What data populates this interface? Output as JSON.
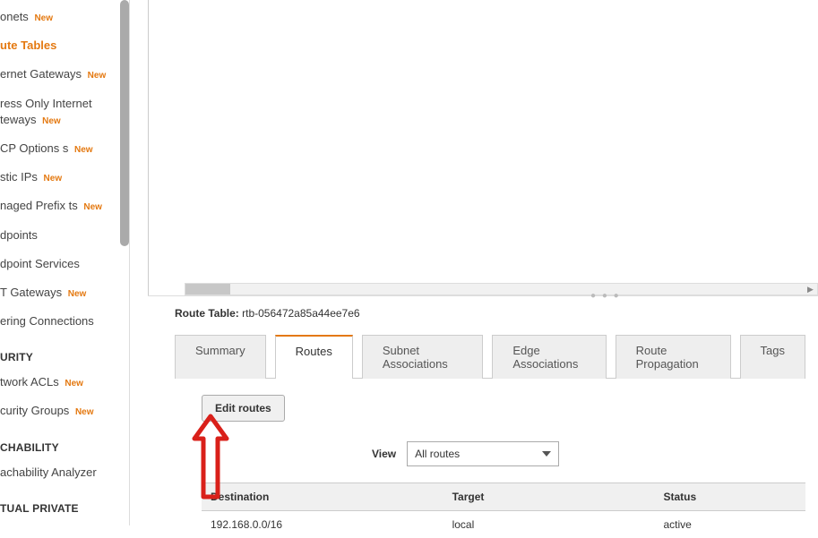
{
  "sidebar": {
    "items": [
      {
        "label": "onets",
        "new": true,
        "active": false
      },
      {
        "label": "ute Tables",
        "new": false,
        "active": true
      },
      {
        "label": "ernet Gateways",
        "new": true,
        "active": false
      },
      {
        "label": "ress Only Internet teways",
        "new": true,
        "active": false
      },
      {
        "label": "CP Options s",
        "new": true,
        "active": false
      },
      {
        "label": "stic IPs",
        "new": true,
        "active": false
      },
      {
        "label": "naged Prefix ts",
        "new": true,
        "active": false
      },
      {
        "label": "dpoints",
        "new": false,
        "active": false
      },
      {
        "label": "dpoint Services",
        "new": false,
        "active": false
      },
      {
        "label": "T Gateways",
        "new": true,
        "active": false
      },
      {
        "label": "ering Connections",
        "new": false,
        "active": false
      }
    ],
    "sec_heading": "URITY",
    "sec_items": [
      {
        "label": "twork ACLs",
        "new": true
      },
      {
        "label": "curity Groups",
        "new": true
      }
    ],
    "reach_heading": "CHABILITY",
    "reach_items": [
      {
        "label": "achability Analyzer",
        "new": false
      }
    ],
    "vpn_heading": "TUAL PRIVATE"
  },
  "detail": {
    "label_prefix": "Route Table:",
    "rt_id": "rtb-056472a85a44ee7e6",
    "tabs": [
      {
        "label": "Summary",
        "active": false
      },
      {
        "label": "Routes",
        "active": true
      },
      {
        "label": "Subnet Associations",
        "active": false
      },
      {
        "label": "Edge Associations",
        "active": false
      },
      {
        "label": "Route Propagation",
        "active": false
      },
      {
        "label": "Tags",
        "active": false
      }
    ],
    "edit_btn": "Edit routes",
    "view_label": "View",
    "view_value": "All routes",
    "columns": {
      "dest": "Destination",
      "target": "Target",
      "status": "Status"
    },
    "rows": [
      {
        "dest": "192.168.0.0/16",
        "target": "local",
        "status": "active"
      }
    ]
  },
  "new_badge_text": "New"
}
